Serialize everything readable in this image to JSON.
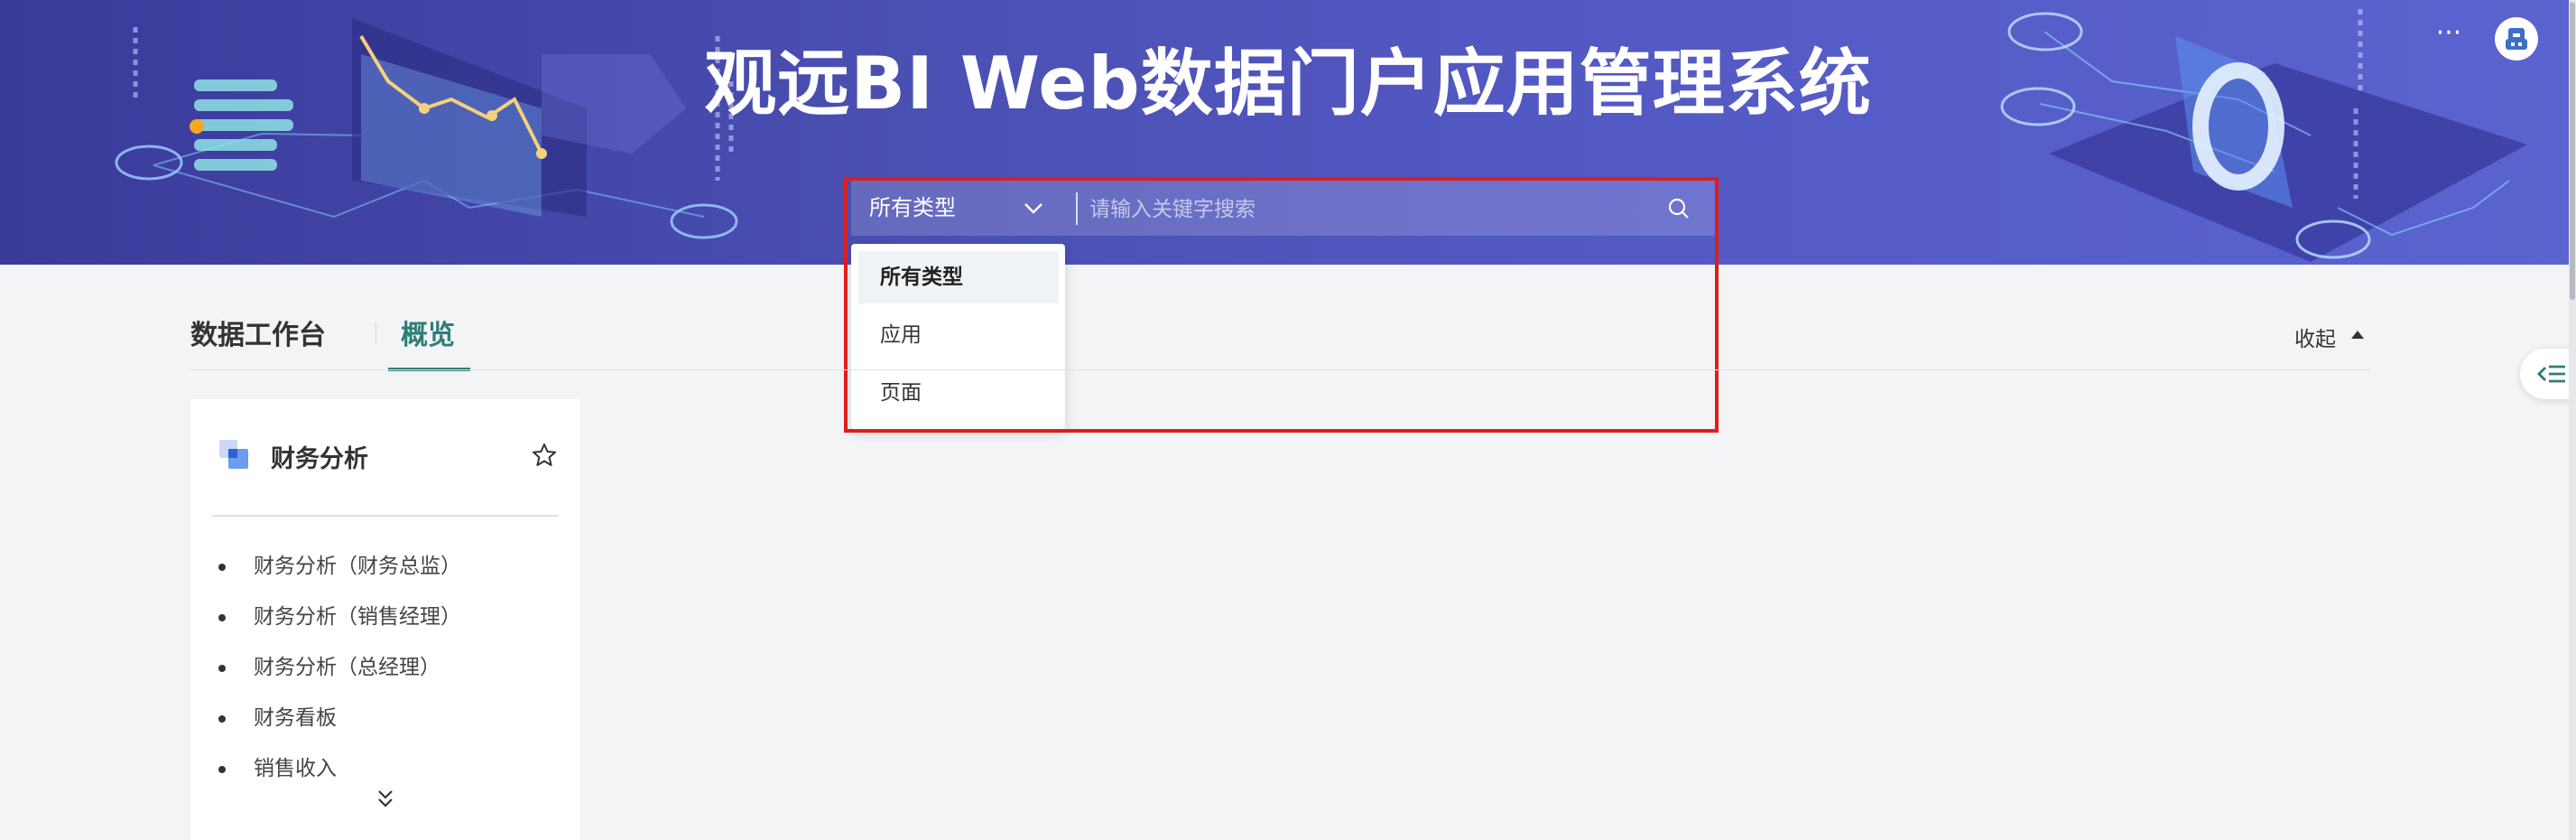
{
  "header": {
    "title": "观远BI Web数据门户应用管理系统",
    "more_label": "···"
  },
  "search": {
    "type_selected": "所有类型",
    "placeholder": "请输入关键字搜索",
    "type_options": [
      "所有类型",
      "应用",
      "页面"
    ],
    "active_option": "所有类型"
  },
  "tabs": {
    "workbench": "数据工作台",
    "overview": "概览",
    "active": "概览"
  },
  "collapse_label": "收起",
  "card": {
    "title": "财务分析",
    "items": [
      "财务分析（财务总监）",
      "财务分析（销售经理）",
      "财务分析（总经理）",
      "财务看板",
      "销售收入"
    ]
  },
  "colors": {
    "banner_start": "#3a3a9a",
    "banner_end": "#5a63cf",
    "accent": "#2e7d76",
    "highlight": "#e01c1c",
    "page_bg": "#f2f4f6"
  },
  "icons": {
    "search": "search-icon",
    "dropdown": "chevron-down-icon",
    "favorite": "star-icon",
    "expand": "double-chevron-down-icon",
    "user": "avatar-icon",
    "more": "ellipsis-icon",
    "side": "indent-menu-icon"
  }
}
